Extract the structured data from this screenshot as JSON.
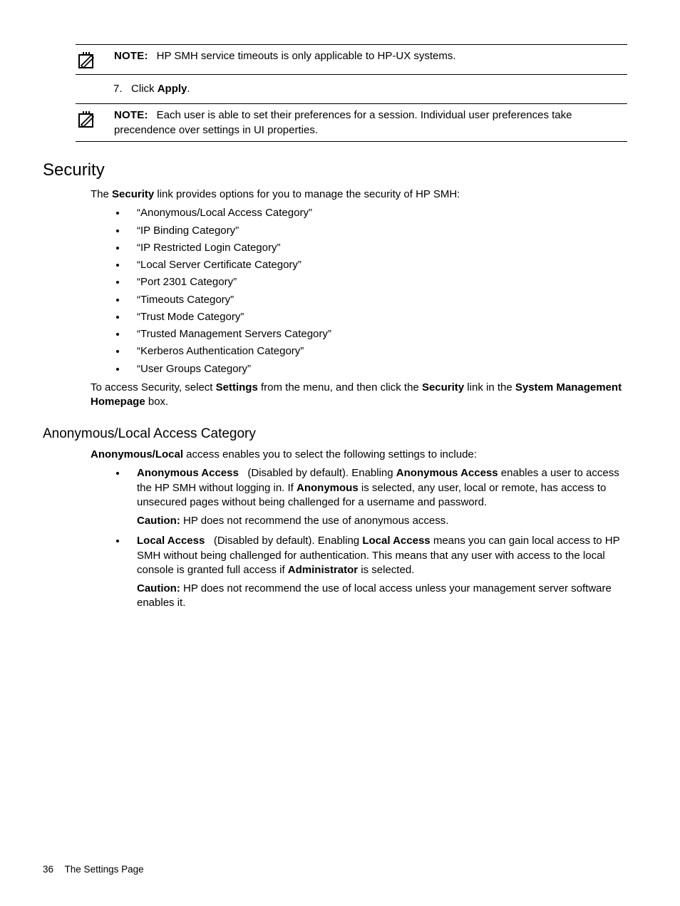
{
  "note1": {
    "label": "NOTE:",
    "text": "HP SMH service timeouts is only applicable to HP-UX systems."
  },
  "step7": {
    "number": "7.",
    "prefix": "Click ",
    "bold": "Apply",
    "suffix": "."
  },
  "note2": {
    "label": "NOTE:",
    "text": "Each user is able to set their preferences for a session. Individual user preferences take precendence over settings in UI properties."
  },
  "security": {
    "heading": "Security",
    "intro_pre": "The ",
    "intro_bold": "Security",
    "intro_post": " link provides options for you to manage the security of HP SMH:",
    "links": [
      "“Anonymous/Local Access Category”",
      "“IP Binding Category”",
      "“IP Restricted Login Category”",
      "“Local Server Certificate Category”",
      "“Port 2301 Category”",
      "“Timeouts Category”",
      "“Trust Mode Category”",
      "“Trusted Management Servers Category”",
      "“Kerberos Authentication Category”",
      "“User Groups Category”"
    ],
    "access_p1": "To access Security, select ",
    "access_b1": "Settings",
    "access_p2": " from the menu, and then click the ",
    "access_b2": "Security",
    "access_p3": " link in the ",
    "access_b3": "System Management Homepage",
    "access_p4": " box."
  },
  "anonLocal": {
    "heading": "Anonymous/Local Access Category",
    "intro_b": "Anonymous/Local",
    "intro_post": " access enables you to select the following settings to include:",
    "items": [
      {
        "term": "Anonymous Access",
        "body_pre": "   (Disabled by default). Enabling ",
        "body_b1": "Anonymous Access",
        "body_mid": " enables a user to access the HP SMH without logging in. If ",
        "body_b2": "Anonymous",
        "body_post": " is selected, any user, local or remote, has access to unsecured pages without being challenged for a username and password.",
        "caution_label": "Caution:",
        "caution_text": " HP does not recommend the use of anonymous access."
      },
      {
        "term": "Local Access",
        "body_pre": "   (Disabled by default). Enabling ",
        "body_b1": "Local Access",
        "body_mid": " means you can gain local access to HP SMH without being challenged for authentication. This means that any user with access to the local console is granted full access if ",
        "body_b2": "Administrator",
        "body_post": " is selected.",
        "caution_label": "Caution:",
        "caution_text": " HP does not recommend the use of local access unless your management server software enables it."
      }
    ]
  },
  "footer": {
    "page": "36",
    "title": "The Settings Page"
  }
}
